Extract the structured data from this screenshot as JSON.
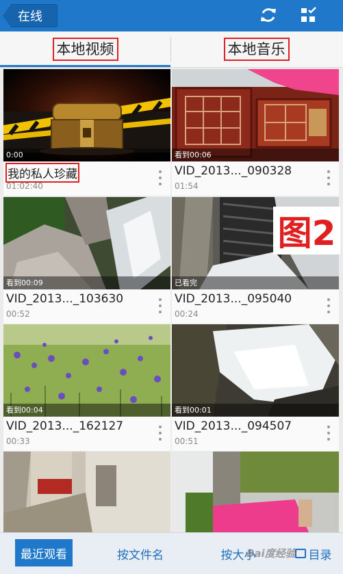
{
  "header": {
    "back_label": "在线",
    "refresh_icon": "refresh-icon",
    "select_icon": "checklist-icon"
  },
  "tabs": [
    {
      "label": "本地视频",
      "active": true
    },
    {
      "label": "本地音乐",
      "active": false
    }
  ],
  "videos": [
    {
      "title": "我的私人珍藏",
      "duration": "01:02:40",
      "progress": "0:00"
    },
    {
      "title": "VID_2013..._090328",
      "duration": "01:54",
      "progress": "看到00:06"
    },
    {
      "title": "VID_2013..._103630",
      "duration": "00:52",
      "progress": "看到00:09"
    },
    {
      "title": "VID_2013..._095040",
      "duration": "00:24",
      "progress": "已看完"
    },
    {
      "title": "VID_2013..._162127",
      "duration": "00:33",
      "progress": "看到00:04"
    },
    {
      "title": "VID_2013..._094507",
      "duration": "00:51",
      "progress": "看到00:01"
    }
  ],
  "annotation": {
    "figure_label": "图2"
  },
  "bottom_bar": {
    "recent": "最近观看",
    "by_filename": "按文件名",
    "by_size": "按大小",
    "directory": "目录"
  },
  "watermark": "Bai度经验",
  "colors": {
    "accent": "#1f78c9",
    "highlight": "#e02020"
  }
}
